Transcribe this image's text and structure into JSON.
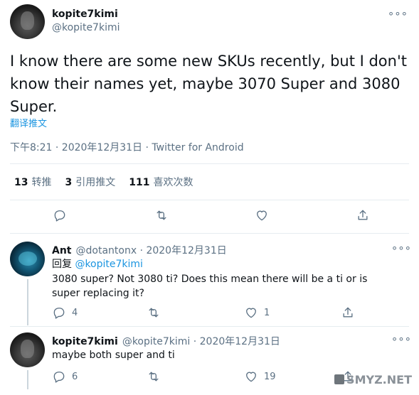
{
  "main": {
    "name": "kopite7kimi",
    "handle": "@kopite7kimi",
    "text": "I know there are some new SKUs recently, but I don't know their names yet, maybe 3070 Super and 3080 Super.",
    "translate": "翻译推文",
    "meta": "下午8:21 · 2020年12月31日 · Twitter for Android",
    "stats": {
      "retweets_count": "13",
      "retweets_label": "转推",
      "quotes_count": "3",
      "quotes_label": "引用推文",
      "likes_count": "111",
      "likes_label": "喜欢次数"
    }
  },
  "replies": [
    {
      "name": "Ant",
      "handle": "@dotantonx",
      "date": "· 2020年12月31日",
      "reply_prefix": "回复",
      "reply_to": "@kopite7kimi",
      "text": "3080 super? Not 3080 ti? Does this mean there will be a ti or is super replacing it?",
      "replies": "4",
      "retweets": "",
      "likes": "1"
    },
    {
      "name": "kopite7kimi",
      "handle": "@kopite7kimi",
      "date": "· 2020年12月31日",
      "text": "maybe both super and ti",
      "replies": "6",
      "retweets": "",
      "likes": "19"
    }
  ],
  "more_glyph": "∘∘∘",
  "watermark": "SMYZ.NET",
  "icons": [
    "reply-icon",
    "retweet-icon",
    "like-icon",
    "share-icon",
    "more-icon"
  ],
  "colors": {
    "link": "#1b95e0",
    "muted": "#5b7083",
    "divider": "#e6ecf0"
  }
}
